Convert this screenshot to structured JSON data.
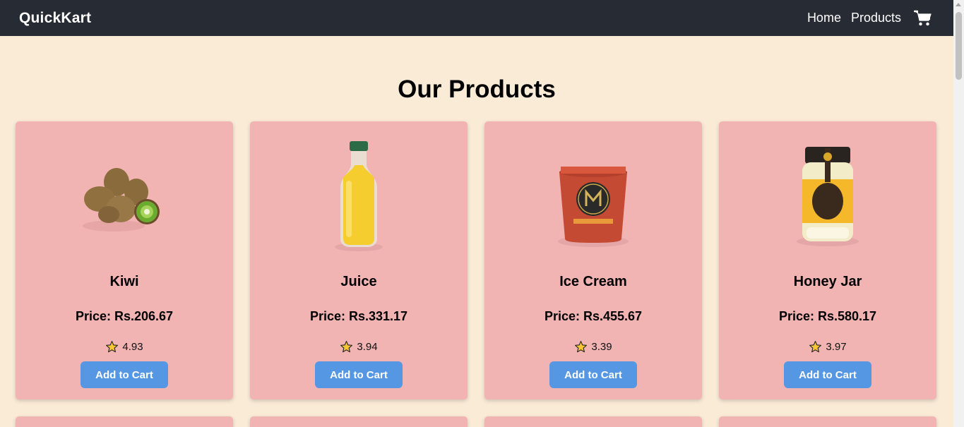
{
  "navbar": {
    "brand": "QuickKart",
    "links": [
      "Home",
      "Products"
    ],
    "cart_icon": "shopping-cart-icon"
  },
  "page": {
    "title": "Our Products"
  },
  "products": [
    {
      "name": "Kiwi",
      "price": "Price: Rs.206.67",
      "rating": "4.93",
      "button": "Add to Cart",
      "image": "kiwi-image"
    },
    {
      "name": "Juice",
      "price": "Price: Rs.331.17",
      "rating": "3.94",
      "button": "Add to Cart",
      "image": "juice-bottle-image"
    },
    {
      "name": "Ice Cream",
      "price": "Price: Rs.455.67",
      "rating": "3.39",
      "button": "Add to Cart",
      "image": "ice-cream-tub-image"
    },
    {
      "name": "Honey Jar",
      "price": "Price: Rs.580.17",
      "rating": "3.97",
      "button": "Add to Cart",
      "image": "honey-jar-image"
    }
  ],
  "colors": {
    "navbar": "#272b33",
    "background": "#faebd7",
    "card": "#f2b3b3",
    "button": "#5597e2",
    "star": "#f7c631"
  }
}
